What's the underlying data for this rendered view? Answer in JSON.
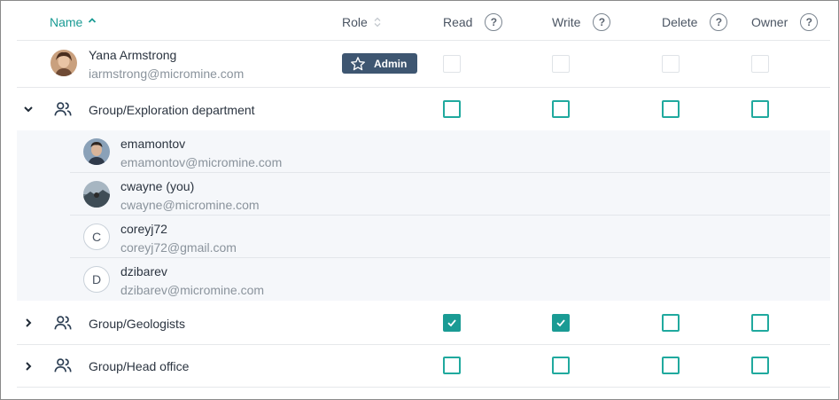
{
  "header": {
    "name": "Name",
    "role": "Role",
    "read": "Read",
    "write": "Write",
    "delete": "Delete",
    "owner": "Owner",
    "help_glyph": "?"
  },
  "owner_row": {
    "name": "Yana Armstrong",
    "email": "iarmstrong@micromine.com",
    "role_badge": "Admin",
    "avatar_icon": "user-photo",
    "permissions": {
      "read": false,
      "write": false,
      "delete": false,
      "owner": false
    },
    "permissions_disabled": true
  },
  "groups": [
    {
      "name": "Group/Exploration department",
      "expanded": true,
      "permissions": {
        "read": false,
        "write": false,
        "delete": false,
        "owner": false
      },
      "members": [
        {
          "name": "emamontov",
          "email": "emamontov@micromine.com",
          "avatar": "photo"
        },
        {
          "name": "cwayne (you)",
          "email": "cwayne@micromine.com",
          "avatar": "photo"
        },
        {
          "name": "coreyj72",
          "email": "coreyj72@gmail.com",
          "avatar": "C"
        },
        {
          "name": "dzibarev",
          "email": "dzibarev@micromine.com",
          "avatar": "D"
        }
      ]
    },
    {
      "name": "Group/Geologists",
      "expanded": false,
      "permissions": {
        "read": true,
        "write": true,
        "delete": false,
        "owner": false
      }
    },
    {
      "name": "Group/Head office",
      "expanded": false,
      "permissions": {
        "read": false,
        "write": false,
        "delete": false,
        "owner": false
      }
    }
  ],
  "colors": {
    "accent": "#1a9b94",
    "badge": "#3e5671",
    "text": "#2b3440",
    "muted": "#8a939c"
  }
}
